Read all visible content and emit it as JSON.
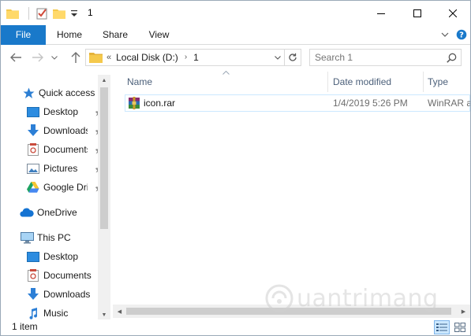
{
  "window": {
    "title": "1",
    "controls": {
      "minimize": "minimize",
      "maximize": "maximize",
      "close": "close"
    }
  },
  "ribbon": {
    "tabs": [
      {
        "id": "file",
        "label": "File"
      },
      {
        "id": "home",
        "label": "Home"
      },
      {
        "id": "share",
        "label": "Share"
      },
      {
        "id": "view",
        "label": "View"
      }
    ]
  },
  "address": {
    "overflow": "«",
    "crumbs": [
      "Local Disk (D:)",
      "1"
    ],
    "separator": "›"
  },
  "search": {
    "placeholder": "Search 1"
  },
  "navpane": {
    "quick_access": {
      "label": "Quick access",
      "items": [
        {
          "label": "Desktop",
          "icon": "desktop-icon"
        },
        {
          "label": "Downloads",
          "icon": "download-icon"
        },
        {
          "label": "Documents",
          "icon": "documents-icon"
        },
        {
          "label": "Pictures",
          "icon": "pictures-icon"
        },
        {
          "label": "Google Drive",
          "icon": "google-drive-icon"
        }
      ]
    },
    "onedrive": {
      "label": "OneDrive"
    },
    "this_pc": {
      "label": "This PC",
      "items": [
        {
          "label": "Desktop",
          "icon": "desktop-icon"
        },
        {
          "label": "Documents",
          "icon": "documents-icon"
        },
        {
          "label": "Downloads",
          "icon": "download-icon"
        },
        {
          "label": "Music",
          "icon": "music-icon"
        }
      ]
    }
  },
  "columns": {
    "name": "Name",
    "date": "Date modified",
    "type": "Type"
  },
  "files": [
    {
      "name": "icon.rar",
      "date": "1/4/2019 5:26 PM",
      "type": "WinRAR archive"
    }
  ],
  "status": {
    "count": "1 item"
  },
  "watermark": {
    "text": "uantrimang"
  },
  "colors": {
    "file_tab": "#1979ca",
    "selection_border": "#cce8ff",
    "column_header": "#4c607a",
    "folder": "#f5c94c"
  }
}
